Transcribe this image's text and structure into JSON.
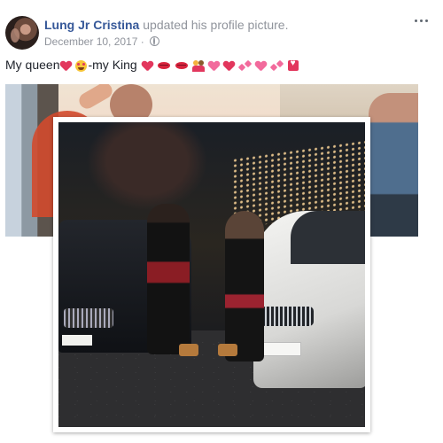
{
  "post": {
    "author": "Lung Jr Cristina",
    "action": "updated his profile picture.",
    "date": "December 10, 2017",
    "separator": "·",
    "privacy_icon": "globe-icon",
    "more_icon": "more-options-icon"
  },
  "caption": {
    "part1": "My queen",
    "part2": "-my King",
    "emojis": [
      "heart",
      "heart-eyes-face",
      "heart",
      "kissing-lips",
      "kissing-lips",
      "couple-kiss",
      "sparkling-heart",
      "heart",
      "two-hearts",
      "heart",
      "two-hearts",
      "heart-box"
    ]
  },
  "colors": {
    "author_link": "#365899",
    "meta_text": "#90949c",
    "heart_red": "#e2375d",
    "heart_pink": "#f26a9c"
  }
}
